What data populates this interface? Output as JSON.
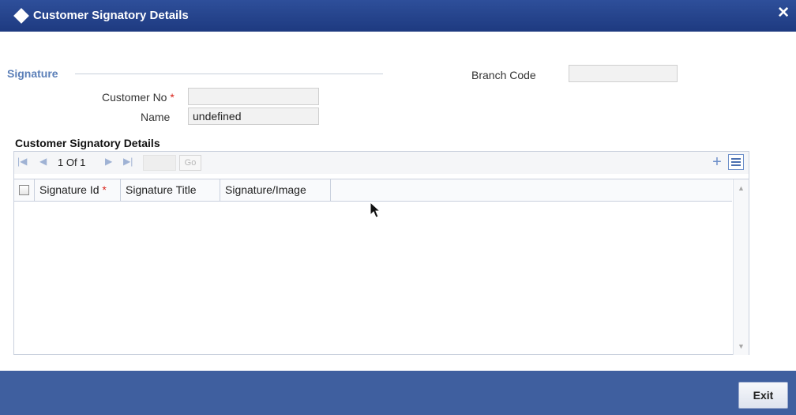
{
  "window": {
    "title": "Customer Signatory Details",
    "close_label": "✕"
  },
  "signature": {
    "legend": "Signature",
    "customer_no_label": "Customer No",
    "customer_no_value": "",
    "name_label": "Name",
    "name_value": "undefined",
    "required_mark": "*"
  },
  "branch": {
    "label": "Branch Code",
    "value": ""
  },
  "grid": {
    "title": "Customer Signatory Details",
    "pager": {
      "text": "1 Of 1",
      "go_label": "Go",
      "first_icon": "first-page-icon",
      "prev_icon": "prev-page-icon",
      "next_icon": "next-page-icon",
      "last_icon": "last-page-icon"
    },
    "columns": [
      "Signature Id",
      "Signature Title",
      "Signature/Image"
    ],
    "required_mark": "*"
  },
  "footer": {
    "exit_label": "Exit"
  },
  "colors": {
    "titlebar": "#2e4f9a",
    "footer": "#3f5f9f",
    "accent": "#5b7fb8",
    "required": "#d9231a"
  }
}
